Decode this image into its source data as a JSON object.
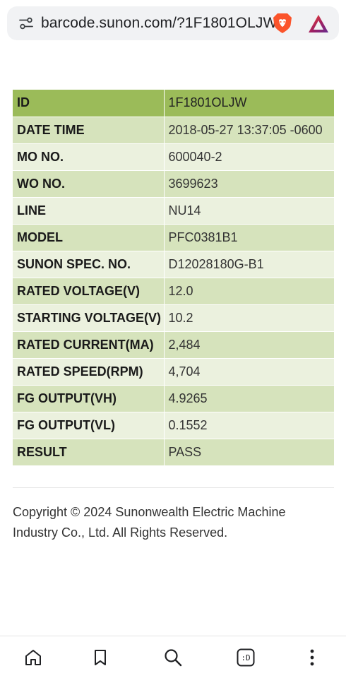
{
  "browser": {
    "url": "barcode.sunon.com/?1F1801OLJW",
    "tab_count_label": ":D",
    "icons": [
      "page-info-icon",
      "brave-shields-icon",
      "brave-rewards-icon"
    ]
  },
  "table": {
    "rows": [
      {
        "label": "ID",
        "value": "1F1801OLJW"
      },
      {
        "label": "DATE TIME",
        "value": "2018-05-27 13:37:05 -0600"
      },
      {
        "label": "MO NO.",
        "value": "600040-2"
      },
      {
        "label": "WO NO.",
        "value": "3699623"
      },
      {
        "label": "LINE",
        "value": "NU14"
      },
      {
        "label": "MODEL",
        "value": "PFC0381B1"
      },
      {
        "label": "SUNON SPEC. NO.",
        "value": "D12028180G-B1"
      },
      {
        "label": "RATED VOLTAGE(V)",
        "value": "12.0"
      },
      {
        "label": "STARTING VOLTAGE(V)",
        "value": "10.2"
      },
      {
        "label": "RATED CURRENT(MA)",
        "value": "2,484"
      },
      {
        "label": "RATED SPEED(RPM)",
        "value": "4,704"
      },
      {
        "label": "FG OUTPUT(VH)",
        "value": "4.9265"
      },
      {
        "label": "FG OUTPUT(VL)",
        "value": "0.1552"
      },
      {
        "label": "RESULT",
        "value": "PASS"
      }
    ]
  },
  "footer": {
    "copyright": "Copyright © 2024 Sunonwealth Electric Machine Industry Co., Ltd. All Rights Reserved."
  },
  "colors": {
    "header_row": "#9bbb59",
    "odd_row": "#d6e3bc",
    "even_row": "#ebf1de",
    "urlbar_bg": "#f1f2f4",
    "brave_orange": "#fb542b",
    "rewards_purple": "#662d91"
  },
  "bottom_nav": {
    "items": [
      "home-icon",
      "bookmark-icon",
      "search-icon",
      "tabs-icon",
      "more-menu-icon"
    ]
  }
}
